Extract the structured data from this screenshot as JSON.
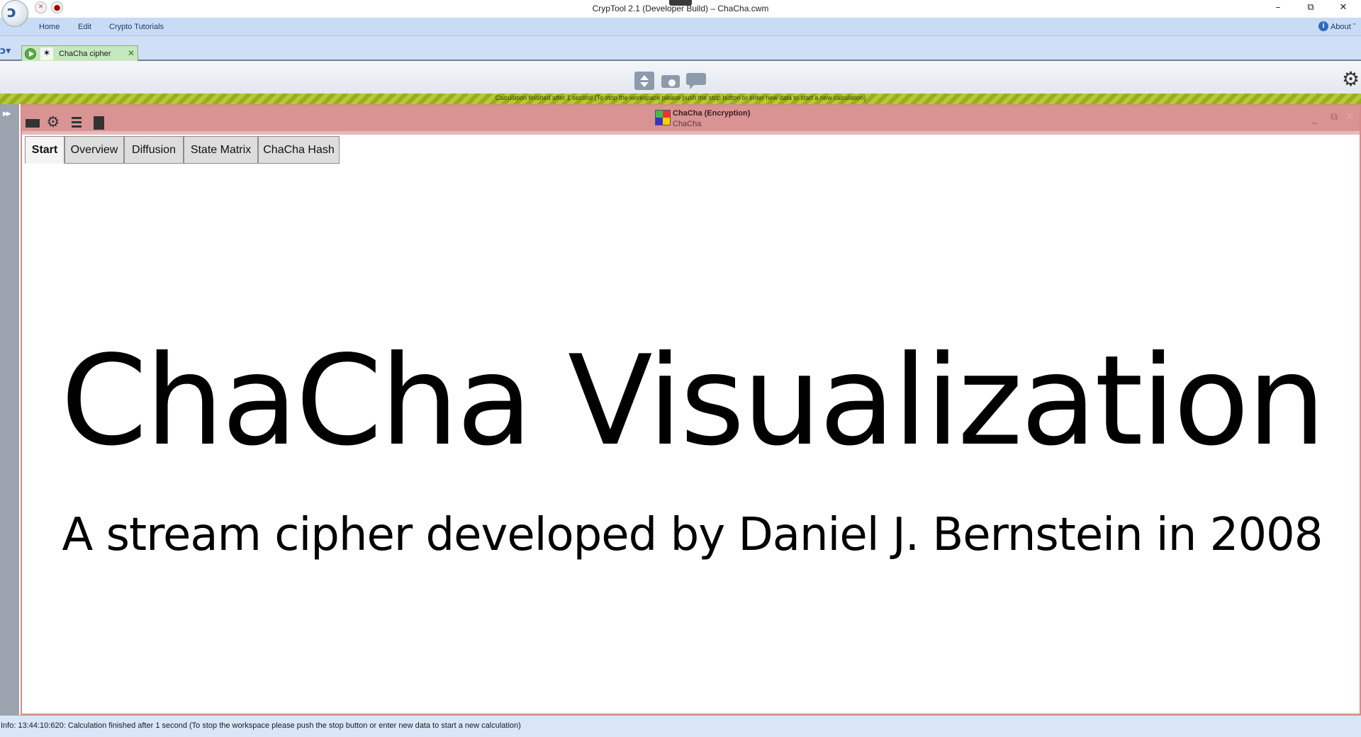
{
  "window": {
    "title": "CrypTool 2.1 (Developer Build) – ChaCha.cwm",
    "min_glyph": "–",
    "max_glyph": "⧉",
    "close_glyph": "✕"
  },
  "quick_access": {
    "stop_icon": "stop-icon",
    "record_icon": "record-icon"
  },
  "menu": {
    "home": "Home",
    "edit": "Edit",
    "tutorials": "Crypto Tutorials",
    "about": "About ˇ"
  },
  "tab": {
    "label": "ChaCha cipher",
    "close_glyph": "✕",
    "color": "#c6e8be"
  },
  "status_stripe": {
    "text": "Calculation finished after 1 second (To stop the workspace please push the stop button or enter new data to start a new calculation)"
  },
  "plugin": {
    "title": "ChaCha (Encryption)",
    "subtitle": "ChaCha",
    "header_color": "#d99393"
  },
  "presentation_tabs": [
    {
      "label": "Start",
      "active": true
    },
    {
      "label": "Overview",
      "active": false
    },
    {
      "label": "Diffusion",
      "active": false
    },
    {
      "label": "State Matrix",
      "active": false
    },
    {
      "label": "ChaCha Hash",
      "active": false
    }
  ],
  "content": {
    "title": "ChaCha Visualization",
    "subtitle": "A stream cipher developed by Daniel J. Bernstein in 2008"
  },
  "statusbar": {
    "text": "Info: 13:44:10:620: Calculation finished after 1 second (To stop the workspace please push the stop button or enter new data to start a new calculation)"
  }
}
